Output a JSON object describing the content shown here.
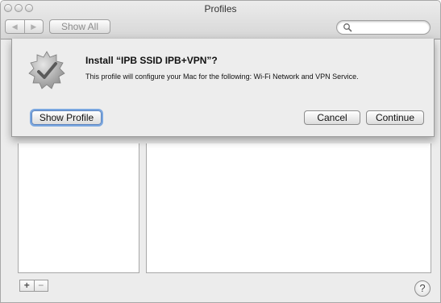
{
  "window": {
    "title": "Profiles"
  },
  "toolbar": {
    "back_glyph": "◀",
    "forward_glyph": "▶",
    "show_all_label": "Show All",
    "search_placeholder": ""
  },
  "sheet": {
    "title": "Install “IPB SSID IPB+VPN”?",
    "message": "This profile will configure your Mac for the following: Wi-Fi Network and VPN Service.",
    "show_profile_label": "Show Profile",
    "cancel_label": "Cancel",
    "continue_label": "Continue",
    "icon": "badge-checkmark-icon"
  },
  "footer": {
    "add_label": "+",
    "remove_label": "−",
    "help_label": "?"
  }
}
